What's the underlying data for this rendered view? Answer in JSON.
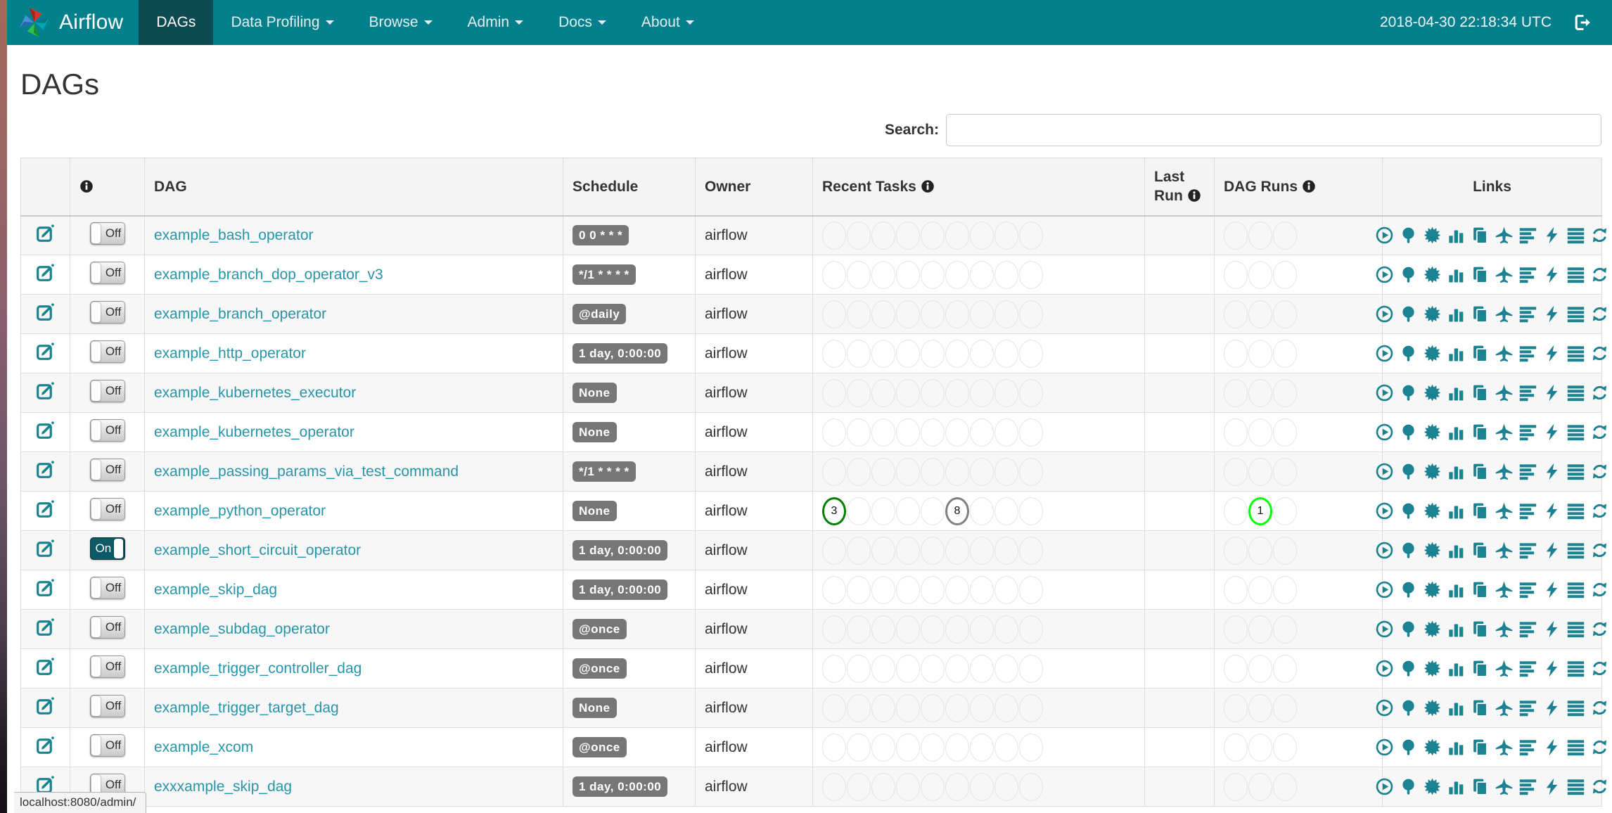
{
  "navbar": {
    "brand": "Airflow",
    "items": [
      {
        "label": "DAGs",
        "active": true,
        "caret": false
      },
      {
        "label": "Data Profiling",
        "active": false,
        "caret": true
      },
      {
        "label": "Browse",
        "active": false,
        "caret": true
      },
      {
        "label": "Admin",
        "active": false,
        "caret": true
      },
      {
        "label": "Docs",
        "active": false,
        "caret": true
      },
      {
        "label": "About",
        "active": false,
        "caret": true
      }
    ],
    "clock": "2018-04-30 22:18:34 UTC",
    "signout_icon": "sign-out-icon"
  },
  "page": {
    "title": "DAGs",
    "search_label": "Search:",
    "search_value": "",
    "status_bar": "localhost:8080/admin/"
  },
  "colors": {
    "navbar_bg": "#04808d",
    "navbar_active_bg": "#0d4a52",
    "link_teal": "#2795a9",
    "icon_teal": "#1a8290",
    "toggle_on_bg": "#0c5a66",
    "badge_bg": "#777777",
    "state_success": "#008000",
    "state_queued": "#808080",
    "state_running": "#00ff00"
  },
  "table": {
    "headers": [
      {
        "label": "",
        "info": false
      },
      {
        "label": "",
        "info": true
      },
      {
        "label": "DAG",
        "info": false
      },
      {
        "label": "Schedule",
        "info": false
      },
      {
        "label": "Owner",
        "info": false
      },
      {
        "label": "Recent Tasks",
        "info": true
      },
      {
        "label": "Last Run",
        "info": true
      },
      {
        "label": "DAG Runs",
        "info": true
      },
      {
        "label": "Links",
        "info": false,
        "center": true
      }
    ],
    "recent_task_slots": 9,
    "dag_run_slots": 3,
    "links": [
      {
        "icon": "play",
        "name": "trigger-dag-icon"
      },
      {
        "icon": "tree",
        "name": "tree-view-icon"
      },
      {
        "icon": "burst",
        "name": "graph-view-icon"
      },
      {
        "icon": "bars",
        "name": "task-duration-icon"
      },
      {
        "icon": "copy",
        "name": "task-tries-icon"
      },
      {
        "icon": "plane",
        "name": "landing-times-icon"
      },
      {
        "icon": "alignleft",
        "name": "gantt-view-icon"
      },
      {
        "icon": "bolt",
        "name": "code-view-icon"
      },
      {
        "icon": "alignjustify",
        "name": "logs-icon"
      },
      {
        "icon": "refresh",
        "name": "refresh-icon"
      }
    ],
    "rows": [
      {
        "name": "example_bash_operator",
        "toggle": "off",
        "schedule": "0 0 * * *",
        "owner": "airflow"
      },
      {
        "name": "example_branch_dop_operator_v3",
        "toggle": "off",
        "schedule": "*/1 * * * *",
        "owner": "airflow"
      },
      {
        "name": "example_branch_operator",
        "toggle": "off",
        "schedule": "@daily",
        "owner": "airflow"
      },
      {
        "name": "example_http_operator",
        "toggle": "off",
        "schedule": "1 day, 0:00:00",
        "owner": "airflow"
      },
      {
        "name": "example_kubernetes_executor",
        "toggle": "off",
        "schedule": "None",
        "owner": "airflow"
      },
      {
        "name": "example_kubernetes_operator",
        "toggle": "off",
        "schedule": "None",
        "owner": "airflow"
      },
      {
        "name": "example_passing_params_via_test_command",
        "toggle": "off",
        "schedule": "*/1 * * * *",
        "owner": "airflow"
      },
      {
        "name": "example_python_operator",
        "toggle": "off",
        "schedule": "None",
        "owner": "airflow",
        "recent_tasks": {
          "0": {
            "count": "3",
            "color": "#008000"
          },
          "5": {
            "count": "8",
            "color": "#808080"
          }
        },
        "dag_runs": {
          "1": {
            "count": "1",
            "color": "#00ff00"
          }
        }
      },
      {
        "name": "example_short_circuit_operator",
        "toggle": "on",
        "schedule": "1 day, 0:00:00",
        "owner": "airflow"
      },
      {
        "name": "example_skip_dag",
        "toggle": "off",
        "schedule": "1 day, 0:00:00",
        "owner": "airflow"
      },
      {
        "name": "example_subdag_operator",
        "toggle": "off",
        "schedule": "@once",
        "owner": "airflow"
      },
      {
        "name": "example_trigger_controller_dag",
        "toggle": "off",
        "schedule": "@once",
        "owner": "airflow"
      },
      {
        "name": "example_trigger_target_dag",
        "toggle": "off",
        "schedule": "None",
        "owner": "airflow"
      },
      {
        "name": "example_xcom",
        "toggle": "off",
        "schedule": "@once",
        "owner": "airflow"
      },
      {
        "name": "exxxample_skip_dag",
        "toggle": "off",
        "schedule": "1 day, 0:00:00",
        "owner": "airflow"
      }
    ],
    "toggle_labels": {
      "on": "On",
      "off": "Off"
    }
  }
}
